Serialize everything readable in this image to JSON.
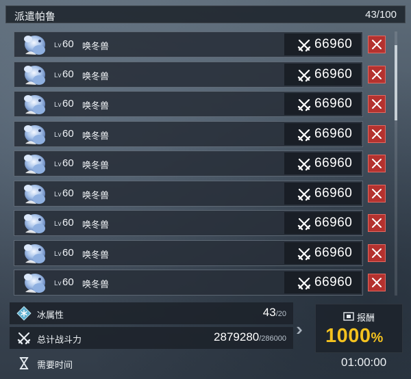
{
  "header": {
    "title": "派遣帕鲁",
    "count": "43/100"
  },
  "rows": [
    {
      "level_prefix": "Lv",
      "level": "60",
      "name": "唤冬兽",
      "power": "66960"
    },
    {
      "level_prefix": "Lv",
      "level": "60",
      "name": "唤冬兽",
      "power": "66960"
    },
    {
      "level_prefix": "Lv",
      "level": "60",
      "name": "唤冬兽",
      "power": "66960"
    },
    {
      "level_prefix": "Lv",
      "level": "60",
      "name": "唤冬兽",
      "power": "66960"
    },
    {
      "level_prefix": "Lv",
      "level": "60",
      "name": "唤冬兽",
      "power": "66960"
    },
    {
      "level_prefix": "Lv",
      "level": "60",
      "name": "唤冬兽",
      "power": "66960"
    },
    {
      "level_prefix": "Lv",
      "level": "60",
      "name": "唤冬兽",
      "power": "66960"
    },
    {
      "level_prefix": "Lv",
      "level": "60",
      "name": "唤冬兽",
      "power": "66960"
    },
    {
      "level_prefix": "Lv",
      "level": "60",
      "name": "唤冬兽",
      "power": "66960"
    }
  ],
  "icons": {
    "portrait": "ice-pal-portrait",
    "power": "crossed-swords-icon",
    "remove": "close-icon",
    "element": "ice-snowflake-icon",
    "time": "hourglass-icon",
    "reward": "reward-chest-icon"
  },
  "summary": {
    "element_label": "冰属性",
    "element_current": "43",
    "element_required": "/20",
    "power_label": "总计战斗力",
    "power_current": "2879280",
    "power_required": "/286000",
    "time_label": "需要时间",
    "time_value": "01:00:00"
  },
  "reward": {
    "label": "报酬",
    "value": "1000",
    "unit": "%"
  },
  "colors": {
    "reward_value": "#f4c21f",
    "remove_button": "#b4322f",
    "element_icon": "#5fb0d0"
  }
}
